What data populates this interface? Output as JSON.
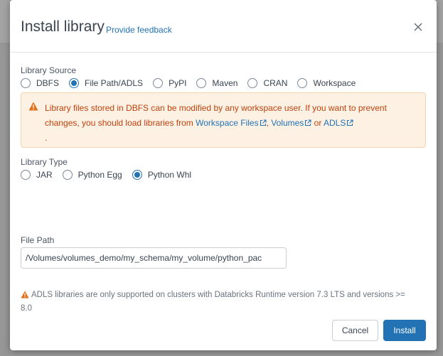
{
  "dialog": {
    "title": "Install library",
    "feedback_link": "Provide feedback",
    "close_icon": "close-icon"
  },
  "library_source": {
    "label": "Library Source",
    "options": [
      "DBFS",
      "File Path/ADLS",
      "PyPI",
      "Maven",
      "CRAN",
      "Workspace"
    ],
    "selected": "File Path/ADLS"
  },
  "warning": {
    "icon": "warning-icon",
    "text_1": "Library files stored in DBFS can be modified by any workspace user. If you want to prevent changes, you should load libraries from ",
    "link_workspace_files": "Workspace Files",
    "sep_1": ", ",
    "link_volumes": "Volumes",
    "sep_2": " or ",
    "link_adls": "ADLS",
    "trailing": "."
  },
  "library_type": {
    "label": "Library Type",
    "options": [
      "JAR",
      "Python Egg",
      "Python Whl"
    ],
    "selected": "Python Whl"
  },
  "file_path": {
    "label": "File Path",
    "value": "/Volumes/volumes_demo/my_schema/my_volume/python_pac"
  },
  "adls_note": {
    "icon": "warning-icon",
    "text": "ADLS libraries are only supported on clusters with Databricks Runtime version 7.3 LTS and versions >= 8.0"
  },
  "footer": {
    "cancel_label": "Cancel",
    "install_label": "Install"
  },
  "colors": {
    "accent": "#2272b4",
    "warning_text": "#c2410c",
    "warning_bg": "#fdf1e4",
    "warning_icon": "#e0701b"
  }
}
